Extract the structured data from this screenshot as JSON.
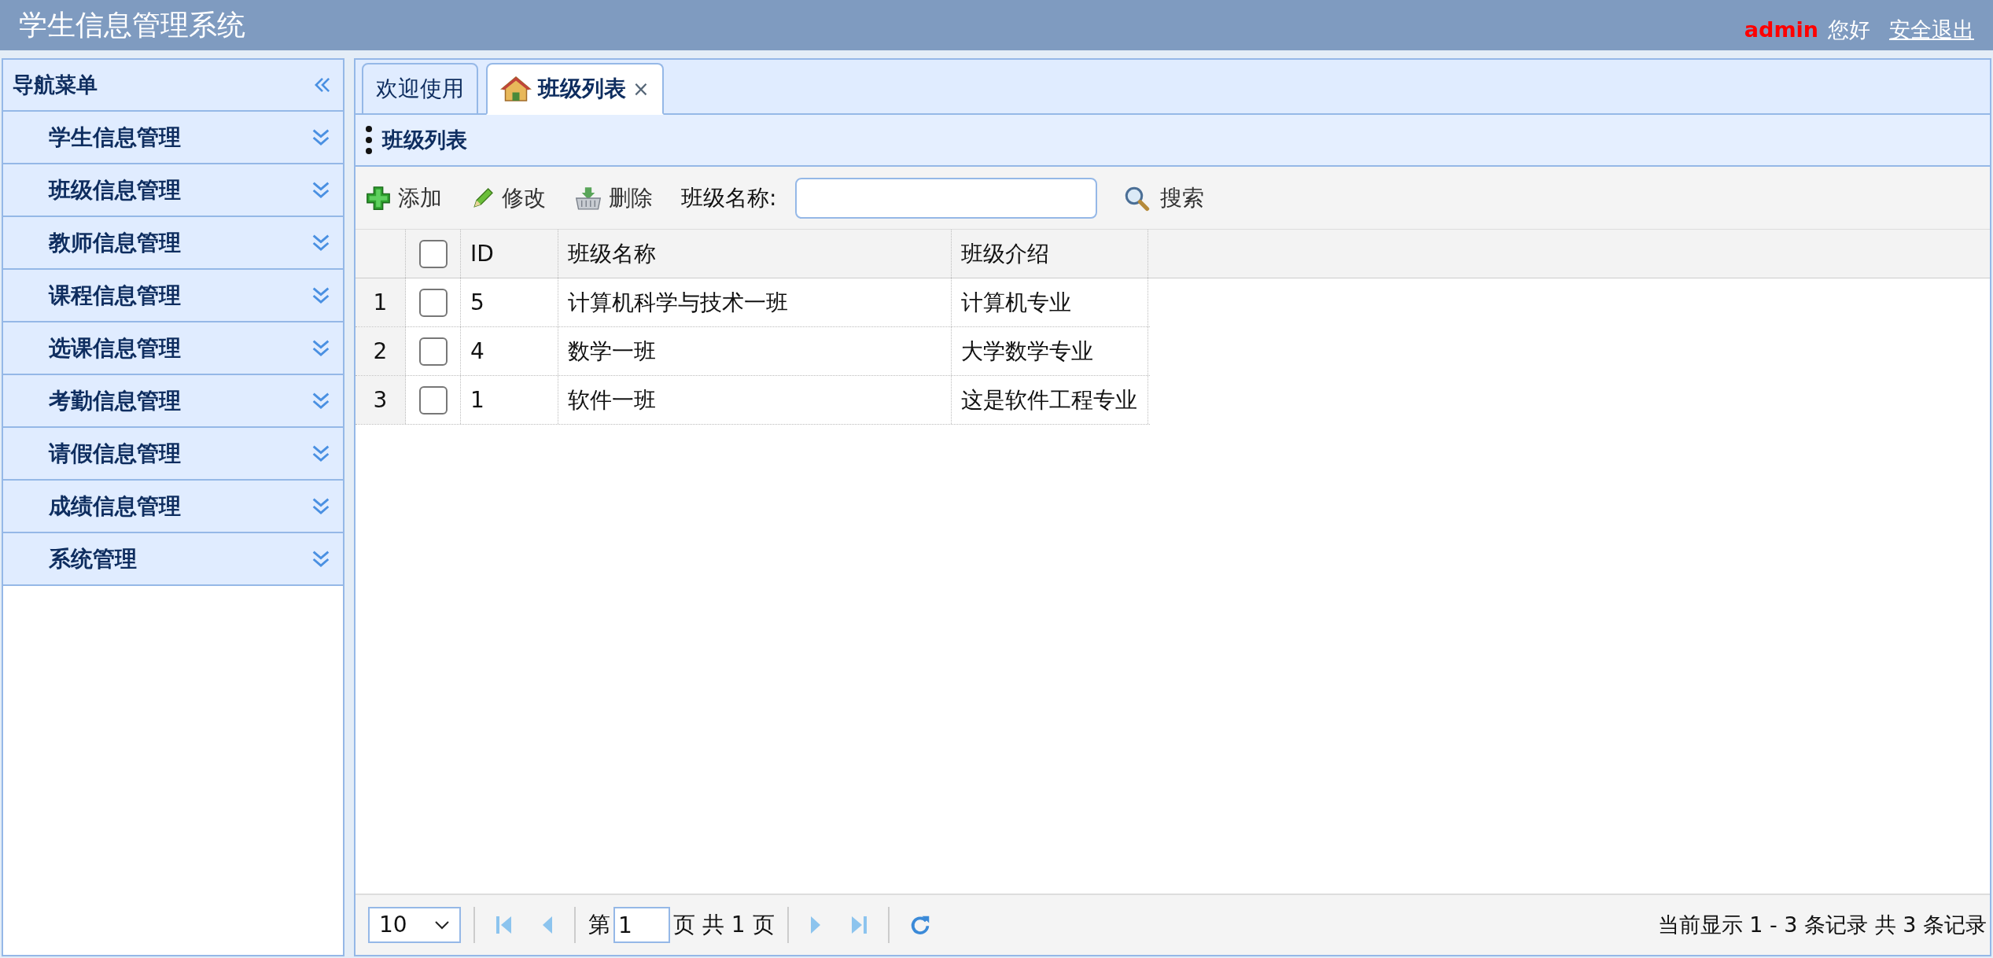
{
  "header": {
    "title": "学生信息管理系统",
    "user": "admin",
    "greeting": "您好",
    "logout": "安全退出"
  },
  "sidebar": {
    "title": "导航菜单",
    "items": [
      {
        "label": "学生信息管理",
        "expanded": false
      },
      {
        "label": "班级信息管理",
        "expanded": false
      },
      {
        "label": "教师信息管理",
        "expanded": false
      },
      {
        "label": "课程信息管理",
        "expanded": false
      },
      {
        "label": "选课信息管理",
        "expanded": false
      },
      {
        "label": "考勤信息管理",
        "expanded": false
      },
      {
        "label": "请假信息管理",
        "expanded": false
      },
      {
        "label": "成绩信息管理",
        "expanded": false
      },
      {
        "label": "系统管理",
        "expanded": false
      }
    ]
  },
  "tabs": [
    {
      "label": "欢迎使用",
      "selected": false,
      "closable": false
    },
    {
      "label": "班级列表",
      "selected": true,
      "closable": true,
      "close": "×"
    }
  ],
  "panel": {
    "title": "班级列表"
  },
  "toolbar": {
    "buttons": [
      {
        "kind": "add",
        "label": "添加"
      },
      {
        "kind": "edit",
        "label": "修改"
      },
      {
        "kind": "delete",
        "label": "删除"
      }
    ],
    "search_label": "班级名称:",
    "search_button": "搜索"
  },
  "table": {
    "all_checked": false,
    "columns": [
      "ID",
      "班级名称",
      "班级介绍"
    ],
    "rows": [
      {
        "number": "1",
        "checked": false,
        "cells": [
          "5",
          "计算机科学与技术一班",
          "计算机专业"
        ]
      },
      {
        "number": "2",
        "checked": false,
        "cells": [
          "4",
          "数学一班",
          "大学数学专业"
        ]
      },
      {
        "number": "3",
        "checked": false,
        "cells": [
          "1",
          "软件一班",
          "这是软件工程专业"
        ]
      }
    ]
  },
  "pager": {
    "page_size": "10",
    "before_page": "第",
    "page": "1",
    "after_page": "页 共 1 页",
    "info": "当前显示 1 - 3 条记录 共 3 条记录"
  }
}
